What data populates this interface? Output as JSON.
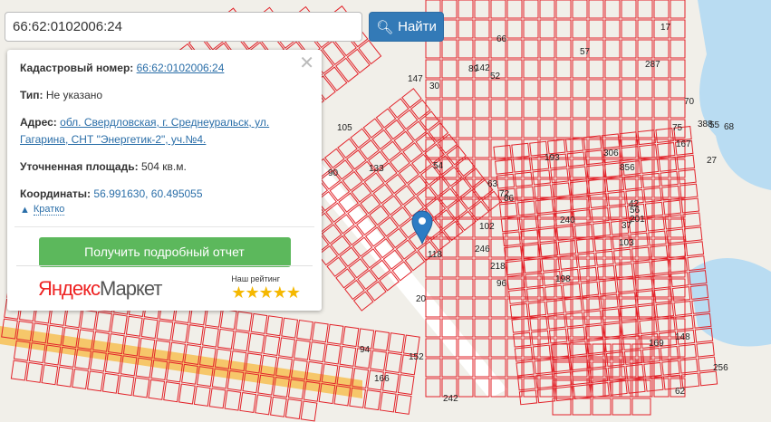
{
  "search": {
    "value": "66:62:0102006:24",
    "button_label": "Найти"
  },
  "popup": {
    "cadastral_label": "Кадастровый номер:",
    "cadastral_value": "66:62:0102006:24",
    "type_label": "Тип:",
    "type_value": "Не указано",
    "address_label": "Адрес:",
    "address_value": "обл. Свердловская, г. Среднеуральск, ул. Гагарина, СНТ \"Энергетик-2\", уч.№4.",
    "area_label": "Уточненная площадь:",
    "area_value": "504 кв.м.",
    "coords_label": "Координаты:",
    "coords_value": "56.991630, 60.495055",
    "brief_link": "Кратко",
    "report_button": "Получить подробный отчет",
    "rating_label": "Наш рейтинг",
    "rating_stars": 5,
    "brand_logo": "Яндекс Маркет"
  },
  "map": {
    "parcel_color": "#e2232a",
    "marker_color": "#2d7cc4",
    "labels": [
      "856",
      "218",
      "240",
      "201",
      "287",
      "17",
      "167",
      "103",
      "27",
      "89",
      "30",
      "152",
      "96",
      "148",
      "75",
      "20",
      "169",
      "166",
      "147",
      "133",
      "142",
      "52",
      "54",
      "70",
      "118",
      "242",
      "306",
      "55",
      "57",
      "94",
      "42",
      "72",
      "66",
      "62",
      "90",
      "68",
      "86",
      "198",
      "388",
      "256",
      "246",
      "193",
      "63",
      "56",
      "105",
      "102",
      "37"
    ]
  }
}
